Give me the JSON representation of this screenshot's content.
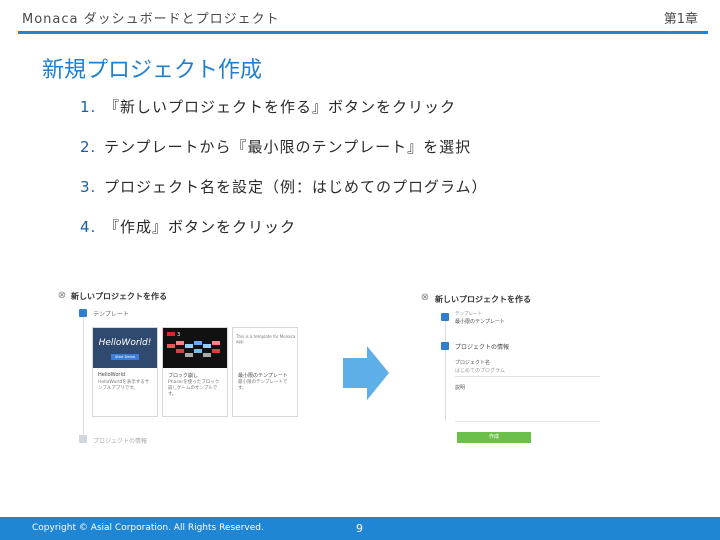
{
  "header": {
    "title": "Monaca ダッシュボードとプロジェクト",
    "chapter": "第1章"
  },
  "slide_title": "新規プロジェクト作成",
  "steps": [
    {
      "num": "1.",
      "text": "『新しいプロジェクトを作る』ボタンをクリック"
    },
    {
      "num": "2.",
      "text": "テンプレートから『最小限のテンプレート』を選択"
    },
    {
      "num": "3.",
      "text": "プロジェクト名を設定（例：はじめてのプログラム）"
    },
    {
      "num": "4.",
      "text": "『作成』ボタンをクリック"
    }
  ],
  "left_screenshot": {
    "dialog_title": "新しいプロジェクトを作る",
    "step1_label": "テンプレート",
    "step2_label": "プロジェクトの情報",
    "cards": [
      {
        "thumb_text": "HelloWorld!",
        "thumb_button": "Start Demo",
        "title": "HelloWorld",
        "desc": "HelloWorldを表示するサンプルアプリです。"
      },
      {
        "thumb_text": "3",
        "title": "ブロック崩し",
        "desc": "Phaserを使ったブロック崩しゲームのサンプルです。"
      },
      {
        "thumb_text": "This is a template for Monaca app",
        "title": "最小限のテンプレート",
        "desc": "最小限のテンプレートです。"
      }
    ]
  },
  "right_screenshot": {
    "dialog_title": "新しいプロジェクトを作る",
    "step1_label": "テンプレート",
    "step1_value": "最小限のテンプレート",
    "step2_label": "プロジェクトの情報",
    "name_label": "プロジェクト名",
    "name_value": "はじめてのプログラム",
    "desc_label": "説明",
    "create_button": "作成"
  },
  "colors": {
    "accent": "#1f86d6",
    "title_blue": "#1f7fd1",
    "arrow_blue": "#5eaee8",
    "create_green": "#6ac04a"
  },
  "footer": {
    "copyright": "Copyright © Asial Corporation. All Rights Reserved.",
    "page_number": "9"
  }
}
